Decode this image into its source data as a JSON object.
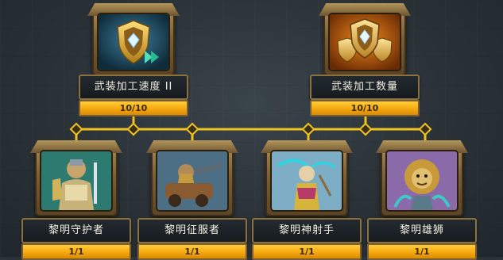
{
  "top_nodes": [
    {
      "name": "武装加工速度 II",
      "progress_text": "10/10",
      "progress": 1.0,
      "icon": "shield-speed-icon"
    },
    {
      "name": "武装加工数量",
      "progress_text": "10/10",
      "progress": 1.0,
      "icon": "shield-quantity-icon"
    }
  ],
  "bottom_nodes": [
    {
      "name": "黎明守护者",
      "progress_text": "1/1",
      "progress": 1.0,
      "icon": "dawn-guardian-portrait"
    },
    {
      "name": "黎明征服者",
      "progress_text": "1/1",
      "progress": 1.0,
      "icon": "dawn-conqueror-portrait"
    },
    {
      "name": "黎明神射手",
      "progress_text": "1/1",
      "progress": 1.0,
      "icon": "dawn-marksman-portrait"
    },
    {
      "name": "黎明雄狮",
      "progress_text": "1/1",
      "progress": 1.0,
      "icon": "dawn-lion-portrait"
    }
  ],
  "colors": {
    "connector": "#f3c21d",
    "progress_fill": "#f5a80f",
    "frame": "#8c7040"
  }
}
